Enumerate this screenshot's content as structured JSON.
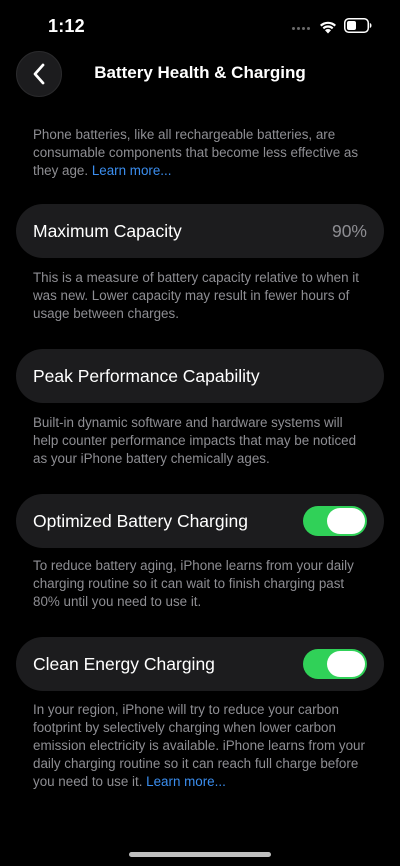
{
  "status_bar": {
    "time": "1:12",
    "icons": [
      "signal-dots-icon",
      "wifi-icon",
      "battery-icon"
    ]
  },
  "nav": {
    "back_icon": "chevron-left-icon",
    "title": "Battery Health & Charging"
  },
  "intro": {
    "text": "Phone batteries, like all rechargeable batteries, are consumable components that become less effective as they age. ",
    "link": "Learn more..."
  },
  "max_capacity": {
    "label": "Maximum Capacity",
    "value": "90%",
    "footer": "This is a measure of battery capacity relative to when it was new. Lower capacity may result in fewer hours of usage between charges."
  },
  "peak_performance": {
    "label": "Peak Performance Capability",
    "footer": "Built-in dynamic software and hardware systems will help counter performance impacts that may be noticed as your iPhone battery chemically ages."
  },
  "optimized_charging": {
    "label": "Optimized Battery Charging",
    "enabled": true,
    "footer": "To reduce battery aging, iPhone learns from your daily charging routine so it can wait to finish charging past 80% until you need to use it."
  },
  "clean_energy": {
    "label": "Clean Energy Charging",
    "enabled": true,
    "footer": "In your region, iPhone will try to reduce your carbon footprint by selectively charging when lower carbon emission electricity is available. iPhone learns from your daily charging routine so it can reach full charge before you need to use it. ",
    "footer_link": "Learn more..."
  },
  "colors": {
    "background": "#000000",
    "cell": "#1c1c1e",
    "secondary_text": "#8e8e93",
    "link": "#3b8eef",
    "toggle_on": "#30d158"
  }
}
